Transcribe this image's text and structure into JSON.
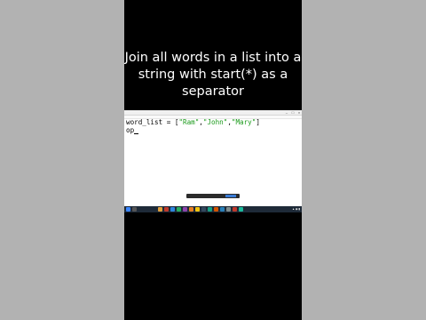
{
  "caption": {
    "line1": "Join all words in a list into a",
    "line2": "string with start(*) as a",
    "line3": "separator"
  },
  "editor": {
    "code_line1_prefix": "word_list = [",
    "str1": "\"Ram\"",
    "sep1": ",",
    "str2": "\"John\"",
    "sep2": ",",
    "str3": "\"Mary\"",
    "code_line1_suffix": "]",
    "code_line2": "op"
  },
  "colors": {
    "side_background": "#b2b2b2",
    "center_background": "#000000",
    "string_literal": "#1a9a1a",
    "taskbar": "#1e2a38"
  },
  "taskbar": {
    "icons": [
      "start-icon",
      "search-icon",
      "edge-icon",
      "folder-icon",
      "chrome-icon",
      "store-icon",
      "mail-icon",
      "python-icon",
      "terminal-icon",
      "settings-icon",
      "app-icon",
      "app-icon",
      "app-icon",
      "app-icon",
      "app-icon",
      "app-icon"
    ]
  }
}
